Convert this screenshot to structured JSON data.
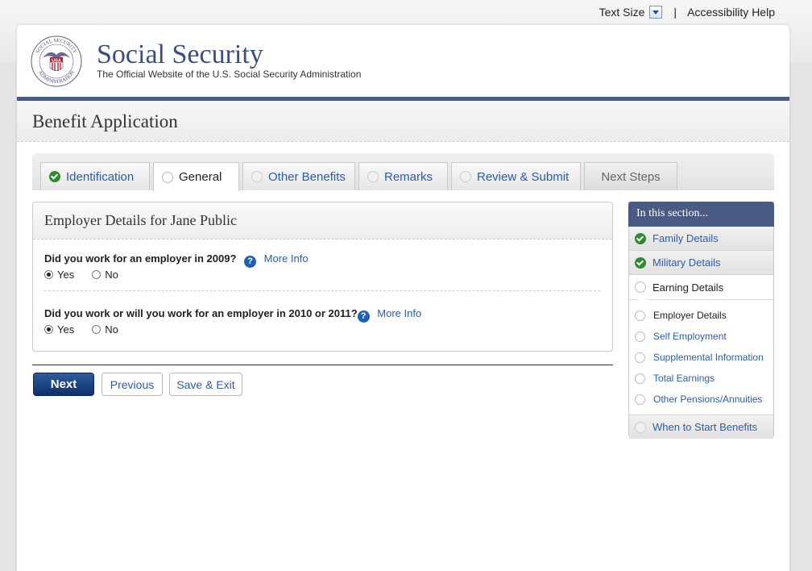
{
  "utility": {
    "text_size": "Text Size",
    "separator": "|",
    "accessibility": "Accessibility Help"
  },
  "header": {
    "title": "Social Security",
    "subtitle": "The Official Website of the U.S. Social Security Administration",
    "seal": {
      "top_text": "SOCIAL SECURITY",
      "bottom_text": "ADMINISTRATION",
      "badge": "USA"
    }
  },
  "app": {
    "title": "Benefit Application"
  },
  "tabs": [
    {
      "label": "Identification",
      "state": "complete"
    },
    {
      "label": "General",
      "state": "active"
    },
    {
      "label": "Other Benefits",
      "state": "incomplete"
    },
    {
      "label": "Remarks",
      "state": "incomplete"
    },
    {
      "label": "Review & Submit",
      "state": "incomplete"
    },
    {
      "label": "Next Steps",
      "state": "disabled"
    }
  ],
  "panel": {
    "title": "Employer Details for Jane Public",
    "questions": [
      {
        "text": "Did you work for an employer in 2009?",
        "more": "More Info",
        "yes": "Yes",
        "no": "No",
        "selected": "Yes"
      },
      {
        "text": "Did you work or will you work for an employer in 2010 or 2011?",
        "more": "More Info",
        "yes": "Yes",
        "no": "No",
        "selected": "Yes"
      }
    ],
    "help_glyph": "?"
  },
  "buttons": {
    "next": "Next",
    "previous": "Previous",
    "save_exit": "Save & Exit"
  },
  "sidebar": {
    "heading": "In this section...",
    "items": [
      {
        "label": "Family Details",
        "state": "complete"
      },
      {
        "label": "Military Details",
        "state": "complete"
      },
      {
        "label": "Earning Details",
        "state": "current"
      }
    ],
    "sub_items": [
      {
        "label": "Employer Details",
        "state": "current"
      },
      {
        "label": "Self Employment"
      },
      {
        "label": "Supplemental Information"
      },
      {
        "label": "Total Earnings"
      },
      {
        "label": "Other Pensions/Annuities"
      }
    ],
    "last_item": {
      "label": "When to Start Benefits"
    }
  },
  "colors": {
    "accent": "#4a5a85",
    "link": "#2a5db0",
    "check": "#2e8b2e",
    "primary_button": "#1a3f7a"
  }
}
